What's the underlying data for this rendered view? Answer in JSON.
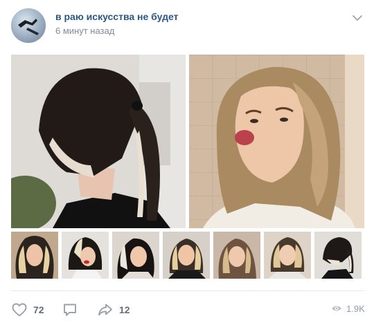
{
  "post": {
    "author": "в раю искусства не будет",
    "time": "6 минут назад"
  },
  "icons": {
    "menu": "chevron-down-icon",
    "like": "heart-icon",
    "comment": "comment-icon",
    "share": "share-arrow-icon",
    "views": "eye-icon"
  },
  "stats": {
    "likes": "72",
    "shares": "12",
    "views": "1.9K"
  },
  "colors": {
    "author_link": "#2a5885",
    "meta_text": "#818c99",
    "action_icon": "#99a2ad"
  }
}
